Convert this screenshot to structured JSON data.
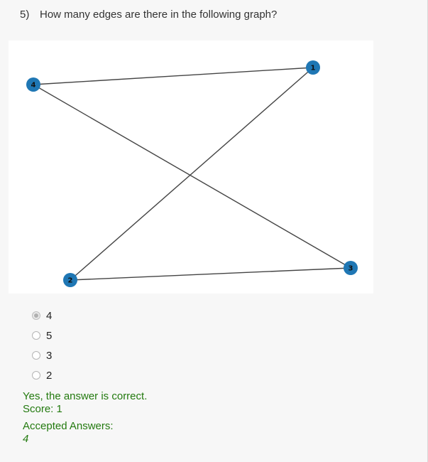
{
  "question": {
    "number": "5)",
    "text": "How many edges are there in the following graph?"
  },
  "graph": {
    "nodes": [
      {
        "id": "1",
        "label": "1"
      },
      {
        "id": "2",
        "label": "2"
      },
      {
        "id": "3",
        "label": "3"
      },
      {
        "id": "4",
        "label": "4"
      }
    ],
    "edges": [
      [
        "4",
        "1"
      ],
      [
        "4",
        "3"
      ],
      [
        "1",
        "2"
      ],
      [
        "2",
        "3"
      ]
    ],
    "node_color": "#1f77b4",
    "edge_color": "#444444"
  },
  "options": [
    {
      "label": "4",
      "selected": true
    },
    {
      "label": "5",
      "selected": false
    },
    {
      "label": "3",
      "selected": false
    },
    {
      "label": "2",
      "selected": false
    }
  ],
  "feedback": {
    "result": "Yes, the answer is correct.",
    "score": "Score: 1",
    "accepted_label": "Accepted Answers:",
    "accepted_value": "4",
    "color": "#237a0f"
  }
}
